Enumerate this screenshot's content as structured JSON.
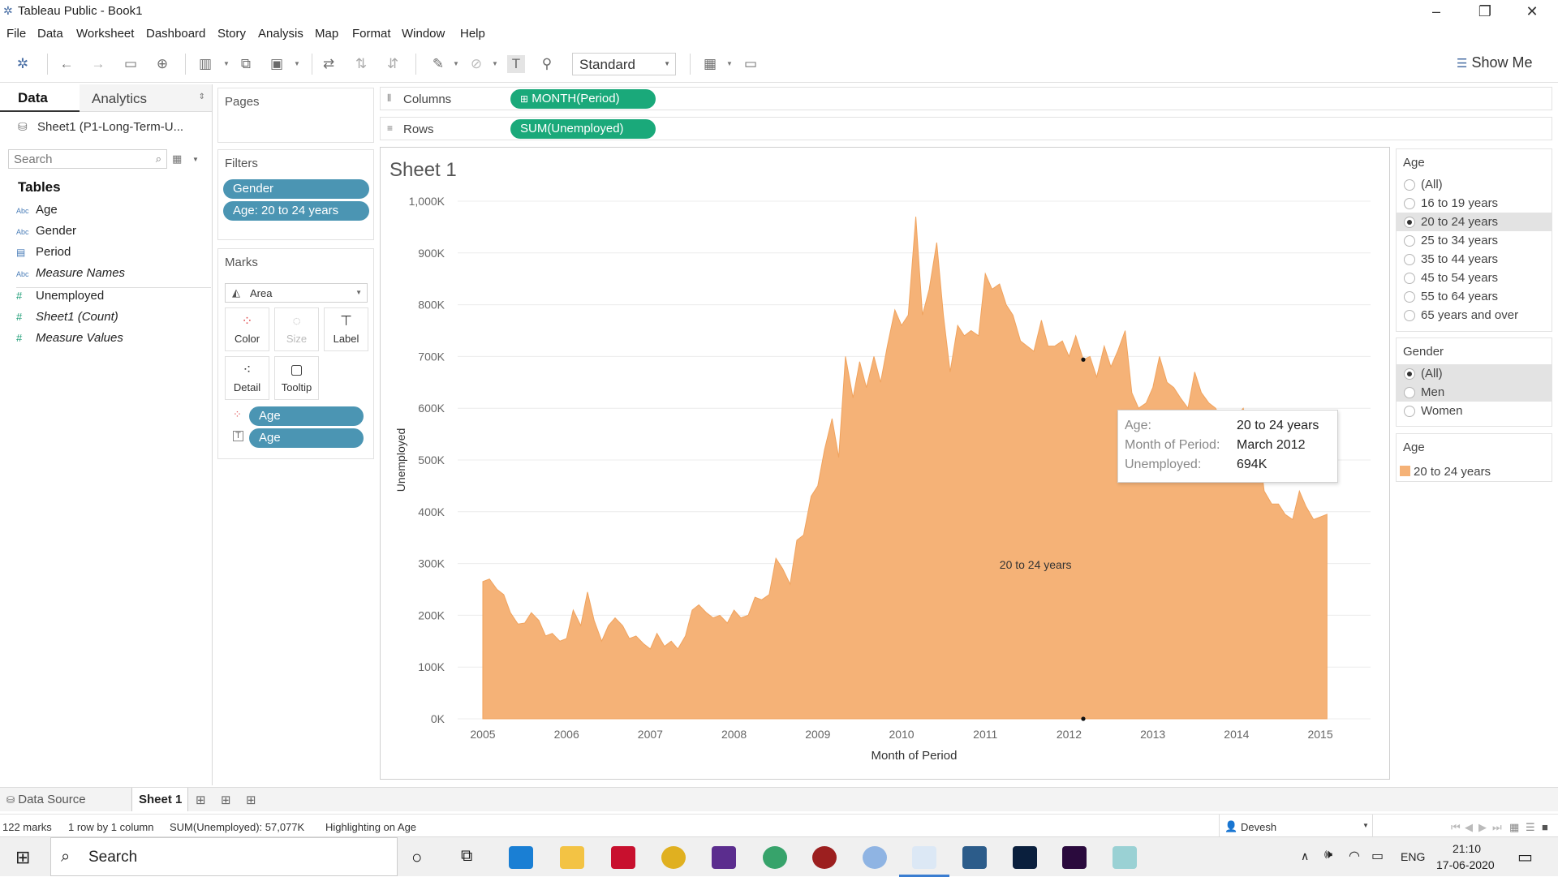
{
  "window": {
    "title": "Tableau Public - Book1"
  },
  "menu": [
    "File",
    "Data",
    "Worksheet",
    "Dashboard",
    "Story",
    "Analysis",
    "Map",
    "Format",
    "Window",
    "Help"
  ],
  "toolbar": {
    "fit_label": "Standard",
    "show_me": "Show Me"
  },
  "data_pane": {
    "tab_data": "Data",
    "tab_analytics": "Analytics",
    "datasource": "Sheet1 (P1-Long-Term-U...",
    "search_placeholder": "Search",
    "tables_heading": "Tables",
    "fields": [
      {
        "label": "Age",
        "type": "Abc"
      },
      {
        "label": "Gender",
        "type": "Abc"
      },
      {
        "label": "Period",
        "type": "date"
      },
      {
        "label": "Measure Names",
        "type": "Abc"
      },
      {
        "label": "Unemployed",
        "type": "#"
      },
      {
        "label": "Sheet1 (Count)",
        "type": "#"
      },
      {
        "label": "Measure Values",
        "type": "#"
      }
    ]
  },
  "pages": {
    "title": "Pages"
  },
  "filters": {
    "title": "Filters",
    "items": [
      "Gender",
      "Age: 20 to 24 years"
    ]
  },
  "marks": {
    "title": "Marks",
    "type": "Area",
    "buttons": [
      "Color",
      "Size",
      "Label",
      "Detail",
      "Tooltip"
    ],
    "pills": [
      "Age",
      "Age"
    ]
  },
  "shelves": {
    "columns_label": "Columns",
    "columns_pill": "MONTH(Period)",
    "rows_label": "Rows",
    "rows_pill": "SUM(Unemployed)"
  },
  "sheet": {
    "title": "Sheet 1"
  },
  "tooltip": {
    "rows": [
      {
        "key": "Age:",
        "value": "20 to 24 years"
      },
      {
        "key": "Month of Period:",
        "value": "March 2012"
      },
      {
        "key": "Unemployed:",
        "value": "694K"
      }
    ]
  },
  "chart_data": {
    "type": "area",
    "title": "",
    "xlabel": "Month of Period",
    "ylabel": "Unemployed",
    "series_color": "#f5b277",
    "series": [
      {
        "name": "20 to 24 years"
      }
    ],
    "area_label": "20 to 24 years",
    "x_ticks": [
      "2005",
      "2006",
      "2007",
      "2008",
      "2009",
      "2010",
      "2011",
      "2012",
      "2013",
      "2014",
      "2015"
    ],
    "y_ticks": [
      "0K",
      "100K",
      "200K",
      "300K",
      "400K",
      "500K",
      "600K",
      "700K",
      "800K",
      "900K",
      "1,000K"
    ],
    "ylim": [
      0,
      1000000
    ],
    "xlim": [
      2004.7,
      2015.6
    ],
    "points": [
      [
        2005.0,
        265000
      ],
      [
        2005.08,
        270000
      ],
      [
        2005.17,
        250000
      ],
      [
        2005.25,
        240000
      ],
      [
        2005.33,
        205000
      ],
      [
        2005.42,
        183000
      ],
      [
        2005.5,
        185000
      ],
      [
        2005.58,
        205000
      ],
      [
        2005.67,
        190000
      ],
      [
        2005.75,
        160000
      ],
      [
        2005.83,
        165000
      ],
      [
        2005.92,
        150000
      ],
      [
        2006.0,
        155000
      ],
      [
        2006.08,
        210000
      ],
      [
        2006.17,
        180000
      ],
      [
        2006.25,
        245000
      ],
      [
        2006.33,
        190000
      ],
      [
        2006.42,
        150000
      ],
      [
        2006.5,
        180000
      ],
      [
        2006.58,
        195000
      ],
      [
        2006.67,
        180000
      ],
      [
        2006.75,
        155000
      ],
      [
        2006.83,
        160000
      ],
      [
        2006.92,
        145000
      ],
      [
        2007.0,
        135000
      ],
      [
        2007.08,
        165000
      ],
      [
        2007.17,
        140000
      ],
      [
        2007.25,
        150000
      ],
      [
        2007.33,
        135000
      ],
      [
        2007.42,
        160000
      ],
      [
        2007.5,
        210000
      ],
      [
        2007.58,
        220000
      ],
      [
        2007.67,
        205000
      ],
      [
        2007.75,
        195000
      ],
      [
        2007.83,
        200000
      ],
      [
        2007.92,
        185000
      ],
      [
        2008.0,
        210000
      ],
      [
        2008.08,
        195000
      ],
      [
        2008.17,
        200000
      ],
      [
        2008.25,
        235000
      ],
      [
        2008.33,
        230000
      ],
      [
        2008.42,
        240000
      ],
      [
        2008.5,
        310000
      ],
      [
        2008.58,
        290000
      ],
      [
        2008.67,
        260000
      ],
      [
        2008.75,
        345000
      ],
      [
        2008.83,
        355000
      ],
      [
        2008.92,
        430000
      ],
      [
        2009.0,
        450000
      ],
      [
        2009.08,
        520000
      ],
      [
        2009.17,
        580000
      ],
      [
        2009.25,
        505000
      ],
      [
        2009.33,
        700000
      ],
      [
        2009.42,
        620000
      ],
      [
        2009.5,
        690000
      ],
      [
        2009.58,
        640000
      ],
      [
        2009.67,
        700000
      ],
      [
        2009.75,
        650000
      ],
      [
        2009.83,
        720000
      ],
      [
        2009.92,
        790000
      ],
      [
        2010.0,
        760000
      ],
      [
        2010.08,
        780000
      ],
      [
        2010.17,
        970000
      ],
      [
        2010.25,
        780000
      ],
      [
        2010.33,
        830000
      ],
      [
        2010.42,
        920000
      ],
      [
        2010.5,
        780000
      ],
      [
        2010.58,
        670000
      ],
      [
        2010.67,
        760000
      ],
      [
        2010.75,
        740000
      ],
      [
        2010.83,
        750000
      ],
      [
        2010.92,
        740000
      ],
      [
        2011.0,
        860000
      ],
      [
        2011.08,
        830000
      ],
      [
        2011.17,
        840000
      ],
      [
        2011.25,
        800000
      ],
      [
        2011.33,
        780000
      ],
      [
        2011.42,
        730000
      ],
      [
        2011.5,
        720000
      ],
      [
        2011.58,
        710000
      ],
      [
        2011.67,
        770000
      ],
      [
        2011.75,
        720000
      ],
      [
        2011.83,
        720000
      ],
      [
        2011.92,
        730000
      ],
      [
        2012.0,
        700000
      ],
      [
        2012.08,
        740000
      ],
      [
        2012.17,
        694000
      ],
      [
        2012.25,
        700000
      ],
      [
        2012.33,
        660000
      ],
      [
        2012.42,
        720000
      ],
      [
        2012.5,
        680000
      ],
      [
        2012.58,
        710000
      ],
      [
        2012.67,
        750000
      ],
      [
        2012.75,
        630000
      ],
      [
        2012.83,
        600000
      ],
      [
        2012.92,
        610000
      ],
      [
        2013.0,
        640000
      ],
      [
        2013.08,
        700000
      ],
      [
        2013.17,
        650000
      ],
      [
        2013.25,
        640000
      ],
      [
        2013.33,
        620000
      ],
      [
        2013.42,
        600000
      ],
      [
        2013.5,
        670000
      ],
      [
        2013.58,
        630000
      ],
      [
        2013.67,
        610000
      ],
      [
        2013.75,
        600000
      ],
      [
        2013.83,
        575000
      ],
      [
        2013.92,
        560000
      ],
      [
        2014.0,
        585000
      ],
      [
        2014.08,
        600000
      ],
      [
        2014.17,
        550000
      ],
      [
        2014.25,
        545000
      ],
      [
        2014.33,
        440000
      ],
      [
        2014.42,
        415000
      ],
      [
        2014.5,
        415000
      ],
      [
        2014.58,
        395000
      ],
      [
        2014.67,
        385000
      ],
      [
        2014.75,
        440000
      ],
      [
        2014.83,
        410000
      ],
      [
        2014.92,
        385000
      ],
      [
        2015.0,
        390000
      ],
      [
        2015.08,
        395000
      ]
    ]
  },
  "legends": {
    "age_filter": {
      "title": "Age",
      "options": [
        "(All)",
        "16 to 19 years",
        "20 to 24 years",
        "25 to 34 years",
        "35 to 44 years",
        "45 to 54 years",
        "55 to 64 years",
        "65 years and over"
      ],
      "selected": 2
    },
    "gender_filter": {
      "title": "Gender",
      "options": [
        "(All)",
        "Men",
        "Women"
      ],
      "selected": 0,
      "hover": 1
    },
    "color": {
      "title": "Age",
      "item": "20 to 24 years",
      "swatch": "#f5b277"
    }
  },
  "tabs": {
    "datasource": "Data Source",
    "sheet": "Sheet 1"
  },
  "status": {
    "marks": "122 marks",
    "dims": "1 row by 1 column",
    "sum": "SUM(Unemployed): 57,077K",
    "highlight": "Highlighting on Age",
    "user": "Devesh"
  },
  "taskbar": {
    "search": "Search",
    "lang": "ENG",
    "time": "21:10",
    "date": "17-06-2020"
  }
}
